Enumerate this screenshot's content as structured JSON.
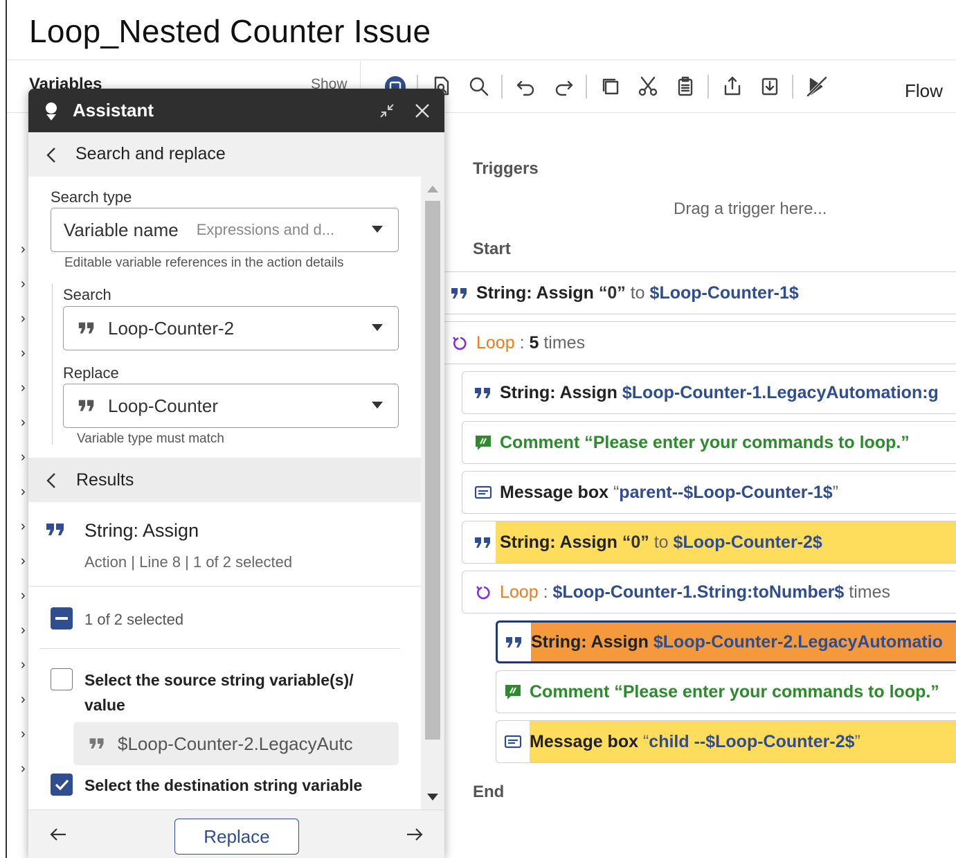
{
  "page": {
    "title": "Loop_Nested Counter Issue"
  },
  "sidebar": {
    "title": "Variables",
    "show_label": "Show"
  },
  "toolbar": {
    "icons": [
      "copilot-icon",
      "search-file-icon",
      "search-icon",
      "undo-icon",
      "redo-icon",
      "copy-icon",
      "cut-icon",
      "paste-icon",
      "export-icon",
      "import-icon",
      "disable-icon"
    ],
    "view_label": "Flow"
  },
  "flow": {
    "triggers_label": "Triggers",
    "drag_hint": "Drag a trigger here...",
    "start_label": "Start",
    "end_label": "End",
    "rows": [
      {
        "action": "String: Assign",
        "value": "“0”",
        "connector": "to",
        "variable": "$Loop-Counter-1$"
      },
      {
        "action": "Loop",
        "separator": ":",
        "count": "5",
        "suffix": "times"
      },
      {
        "action": "String: Assign",
        "variable": "$Loop-Counter-1.LegacyAutomation:g"
      },
      {
        "action": "Comment",
        "text": "“Please enter your commands to loop.”"
      },
      {
        "action": "Message box",
        "open_quote": "“",
        "text_prefix": "parent--",
        "variable": "$Loop-Counter-1$",
        "close_quote": "”"
      },
      {
        "action": "String: Assign",
        "value": "“0”",
        "connector": "to",
        "variable": "$Loop-Counter-2$"
      },
      {
        "action": "Loop",
        "separator": ":",
        "variable": "$Loop-Counter-1.String:toNumber$",
        "suffix": "times"
      },
      {
        "action": "String: Assign",
        "variable": "$Loop-Counter-2.LegacyAutomatio"
      },
      {
        "action": "Comment",
        "text": "“Please enter your commands to loop.”"
      },
      {
        "action": "Message box",
        "open_quote": "“",
        "text_prefix": "child --",
        "variable": "$Loop-Counter-2$",
        "close_quote": "”"
      }
    ],
    "colors": {
      "highlight_yellow": "#ffdd5c",
      "highlight_orange": "#f49a3c",
      "variable_blue": "#2f4d8f",
      "loop_orange": "#f07b1a",
      "comment_green": "#2c8b2c"
    }
  },
  "assistant": {
    "title": "Assistant",
    "subtitle": "Search and replace",
    "search_type_label": "Search type",
    "search_type_value": "Variable name",
    "search_type_detail": "Expressions and d...",
    "search_type_hint": "Editable variable references in the action details",
    "search_label": "Search",
    "search_value": "Loop-Counter-2",
    "replace_label": "Replace",
    "replace_value": "Loop-Counter",
    "replace_hint": "Variable type must match",
    "results_label": "Results",
    "result": {
      "title": "String: Assign",
      "meta": "Action | Line 8 | 1 of 2 selected"
    },
    "selection_summary": "1 of 2 selected",
    "options": [
      {
        "label": "Select the source string variable(s)/ value",
        "checked": false,
        "value": "$Loop-Counter-2.LegacyAutc"
      },
      {
        "label": "Select the destination string variable",
        "checked": true
      }
    ],
    "replace_button": "Replace"
  }
}
